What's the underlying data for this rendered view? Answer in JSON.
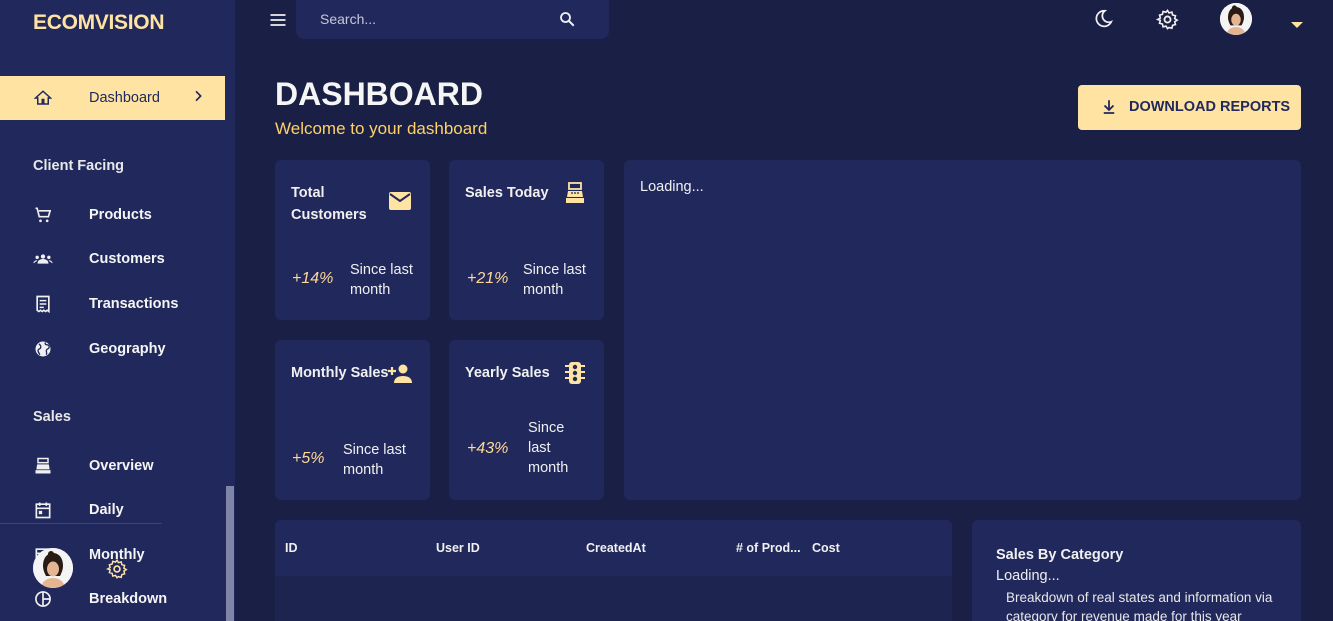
{
  "sidebar": {
    "brand": "ECOMVISION",
    "active_item": {
      "label": "Dashboard",
      "icon": "home-icon"
    },
    "sections": [
      {
        "title": "Client Facing"
      },
      {
        "title": "Sales"
      }
    ],
    "items": [
      {
        "label": "Products",
        "icon": "cart-icon"
      },
      {
        "label": "Customers",
        "icon": "groups-icon"
      },
      {
        "label": "Transactions",
        "icon": "receipt-icon"
      },
      {
        "label": "Geography",
        "icon": "globe-icon"
      },
      {
        "label": "Overview",
        "icon": "point-of-sale-icon"
      },
      {
        "label": "Daily",
        "icon": "calendar-icon"
      },
      {
        "label": "Monthly",
        "icon": "calendar-month-icon"
      },
      {
        "label": "Breakdown",
        "icon": "pie-chart-icon"
      }
    ]
  },
  "topbar": {
    "search_placeholder": "Search...",
    "icons": [
      "menu-icon",
      "search-icon",
      "dark-mode-icon",
      "settings-icon",
      "avatar",
      "caret-down-icon"
    ]
  },
  "header": {
    "title": "DASHBOARD",
    "subtitle": "Welcome to your dashboard",
    "download_label": "DOWNLOAD REPORTS"
  },
  "stats": [
    {
      "title": "Total Customers",
      "increase": "+14%",
      "since": "Since last month",
      "icon": "email-icon"
    },
    {
      "title": "Sales Today",
      "increase": "+21%",
      "since": "Since last month",
      "icon": "point-of-sale-icon"
    },
    {
      "title": "Monthly Sales",
      "increase": "+5%",
      "since": "Since last month",
      "icon": "person-add-icon"
    },
    {
      "title": "Yearly Sales",
      "increase": "+43%",
      "since": "Since last month",
      "icon": "traffic-icon"
    }
  ],
  "overview_panel": {
    "loading": "Loading..."
  },
  "transactions_grid": {
    "columns": [
      "ID",
      "User ID",
      "CreatedAt",
      "# of Prod...",
      "Cost"
    ]
  },
  "sales_by_category": {
    "title": "Sales By Category",
    "loading": "Loading...",
    "description": "Breakdown of real states and information via category for revenue made for this year"
  },
  "colors": {
    "background": "#191f45",
    "panel": "#21295c",
    "accent": "#ffe3a3",
    "accent_text": "#ffd166"
  }
}
